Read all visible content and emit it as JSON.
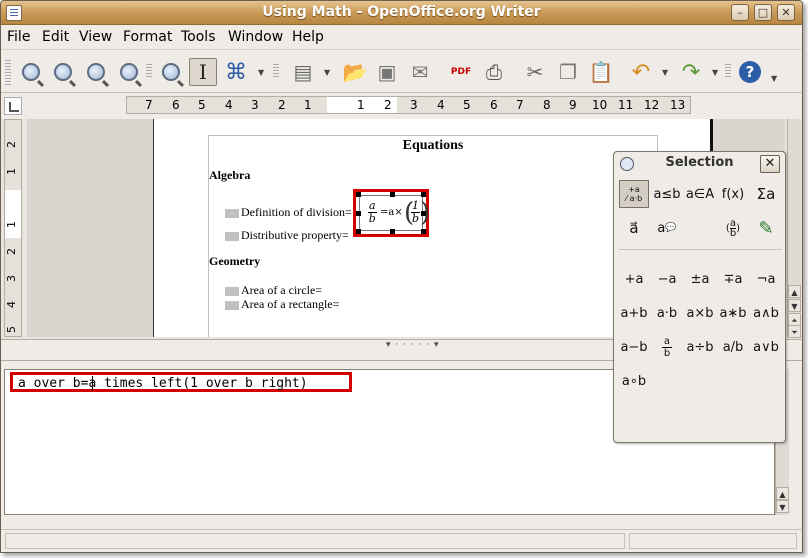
{
  "window": {
    "title": "Using Math - OpenOffice.org Writer",
    "btn_min": "–",
    "btn_max": "□",
    "btn_close": "✕"
  },
  "menu": [
    "File",
    "Edit",
    "View",
    "Format",
    "Tools",
    "Window",
    "Help"
  ],
  "toolbar_icons": [
    "zoom-in-icon",
    "zoom-out-icon",
    "zoom-100-icon",
    "zoom-optimal-icon",
    "zoom-icon",
    "cursor-text-icon",
    "symbols-icon",
    "update-icon",
    "open-icon",
    "save-icon",
    "email-icon",
    "pdf-icon",
    "print-icon",
    "cut-icon",
    "copy-icon",
    "paste-icon",
    "undo-icon",
    "redo-icon",
    "help-icon"
  ],
  "ruler": {
    "h_numbers": [
      "7",
      "6",
      "5",
      "4",
      "3",
      "2",
      "1",
      "",
      "1",
      "2",
      "3",
      "4",
      "5",
      "6",
      "7",
      "8",
      "9",
      "10",
      "11",
      "12",
      "13"
    ],
    "v_numbers": [
      "2",
      "1",
      "1",
      "2",
      "3",
      "4",
      "5"
    ]
  },
  "document": {
    "title": "Equations",
    "sections": [
      {
        "heading": "Algebra",
        "items": [
          "Definition of division=",
          "Distributive property="
        ]
      },
      {
        "heading": "Geometry",
        "items": [
          "Area of a circle=",
          "Area of a rectangle="
        ]
      }
    ],
    "formula": {
      "num": "a",
      "den": "b",
      "middle": "=a×",
      "inner_num": "1",
      "inner_den": "b"
    }
  },
  "command": {
    "text": "a over b=a times left(1 over b right)"
  },
  "selection_panel": {
    "title": "Selection",
    "close": "✕",
    "categories": [
      {
        "name": "unary-binary-category",
        "label": "+a/a·b"
      },
      {
        "name": "relations-category",
        "label": "a≤b"
      },
      {
        "name": "set-operations-category",
        "label": "a∈A"
      },
      {
        "name": "functions-category",
        "label": "f(x)"
      },
      {
        "name": "operators-category",
        "label": "Σa"
      },
      {
        "name": "attributes-category",
        "label": "a⃗"
      },
      {
        "name": "others-category",
        "label": "a💬"
      },
      {
        "name": "brackets-category",
        "label": "(a/b)"
      },
      {
        "name": "formats-category",
        "label": "✎"
      }
    ],
    "symbols": [
      [
        "+a",
        "−a",
        "±a",
        "∓a",
        "¬a"
      ],
      [
        "a+b",
        "a·b",
        "a×b",
        "a∗b",
        "a∧b"
      ],
      [
        "a−b",
        "a/b-frac",
        "a÷b",
        "a/b",
        "a∨b"
      ],
      [
        "a∘b"
      ]
    ]
  }
}
